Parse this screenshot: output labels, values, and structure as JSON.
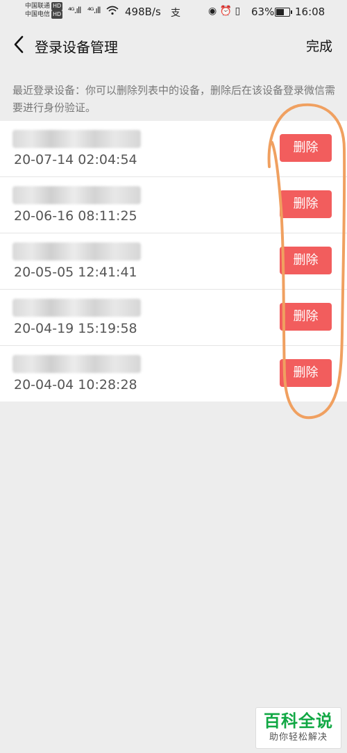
{
  "status_bar": {
    "carrier1": "中国联通",
    "carrier2": "中国电信",
    "hd_badge": "HD",
    "signal1": "⁴ᴳ.ıll",
    "signal2": "⁴ᴳ.ıll",
    "net_speed": "498B/s",
    "app_icon": "支",
    "right_icons": "◉ ⏰ ▯",
    "battery_percent": "63%",
    "battery_level": 0.63,
    "time": "16:08"
  },
  "navbar": {
    "title": "登录设备管理",
    "done_label": "完成"
  },
  "hint": "最近登录设备：你可以删除列表中的设备，删除后在该设备登录微信需要进行身份验证。",
  "delete_label": "删除",
  "devices": [
    {
      "time": "20-07-14 02:04:54"
    },
    {
      "time": "20-06-16 08:11:25"
    },
    {
      "time": "20-05-05 12:41:41"
    },
    {
      "time": "20-04-19 15:19:58"
    },
    {
      "time": "20-04-04 10:28:28"
    }
  ],
  "watermark": {
    "title": "百科全说",
    "subtitle": "助你轻松解决"
  },
  "colors": {
    "delete_button": "#f25d5d",
    "annotation": "#f0a060",
    "watermark_green": "#11a844"
  }
}
